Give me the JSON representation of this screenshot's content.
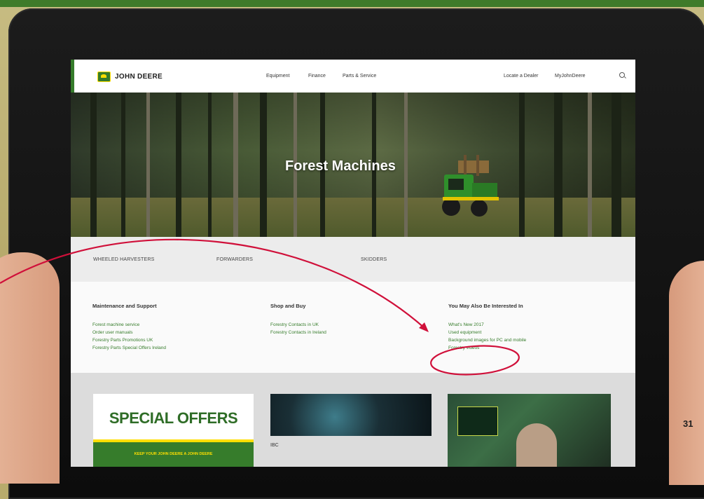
{
  "page": {
    "page_number": "31",
    "accent_green": "#367c2b",
    "accent_yellow": "#ffde00",
    "annotation_color": "#d0103a"
  },
  "nav": {
    "brand": "JOHN DEERE",
    "logo_icon": "deer-logo-icon",
    "links": [
      "Equipment",
      "Finance",
      "Parts & Service"
    ],
    "right_links": [
      "Locate a Dealer",
      "MyJohnDeere"
    ],
    "search_icon": "search-icon"
  },
  "hero": {
    "title": "Forest Machines"
  },
  "categories": [
    "WHEELED HARVESTERS",
    "FORWARDERS",
    "SKIDDERS"
  ],
  "sections": {
    "maintenance": {
      "heading": "Maintenance and Support",
      "items": [
        "Forest machine service",
        "Order user manuals",
        "Forestry Parts Promotions UK",
        "Forestry Parts Special Offers Ireland"
      ]
    },
    "shop": {
      "heading": "Shop and Buy",
      "items": [
        "Forestry Contacts in UK",
        "Forestry Contacts in Ireland"
      ]
    },
    "interested": {
      "heading": "You May Also Be Interested In",
      "items": [
        "What's New 2017",
        "Used equipment",
        "Background images for PC and mobile",
        "Forestry videos"
      ]
    }
  },
  "cards": {
    "special": {
      "title": "SPECIAL OFFERS",
      "footer": "KEEP YOUR JOHN DEERE A JOHN DEERE"
    },
    "second_label": "IBC"
  }
}
